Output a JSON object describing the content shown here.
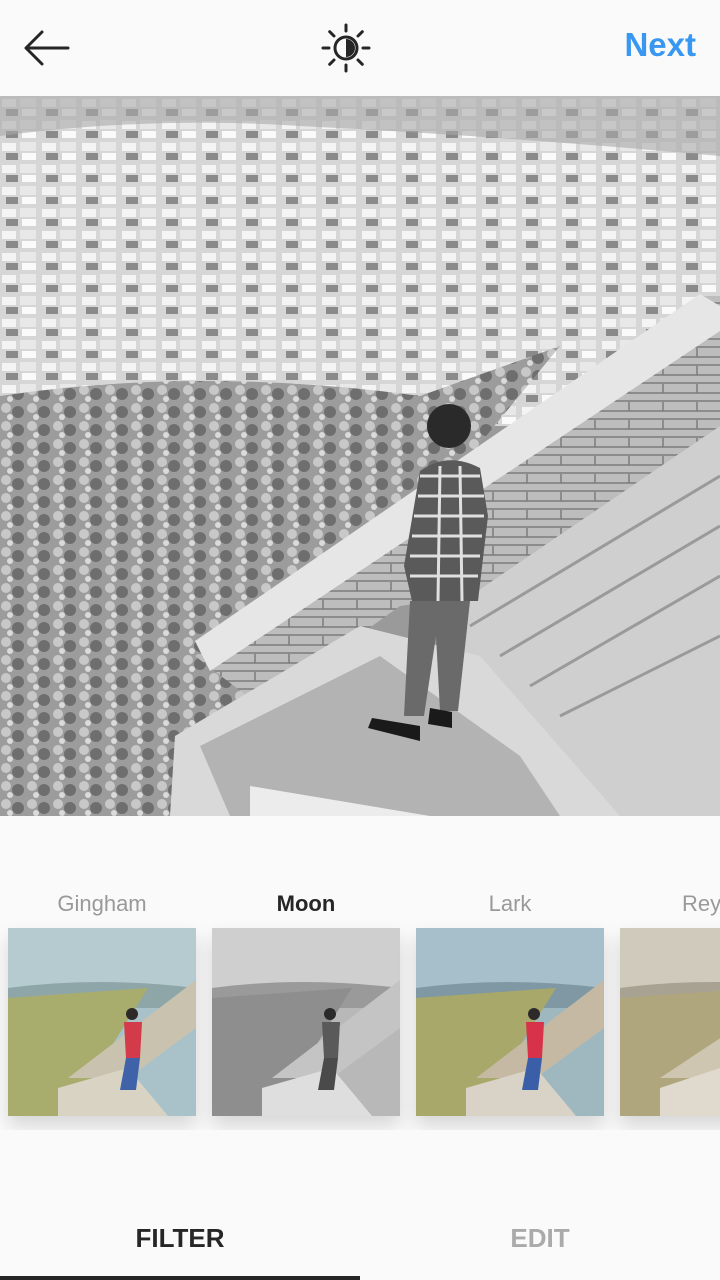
{
  "header": {
    "back_icon": "arrow-left-icon",
    "lux_icon": "sun-contrast-icon",
    "next_label": "Next"
  },
  "preview": {
    "filter_applied": "Moon"
  },
  "filters": [
    {
      "name": "Gingham",
      "selected": false
    },
    {
      "name": "Moon",
      "selected": true
    },
    {
      "name": "Lark",
      "selected": false
    },
    {
      "name": "Rey",
      "selected": false
    }
  ],
  "tabs": {
    "filter_label": "FILTER",
    "edit_label": "EDIT",
    "active": "FILTER"
  },
  "colors": {
    "accent": "#3897f0",
    "text_dark": "#262626",
    "text_muted": "#999999"
  }
}
